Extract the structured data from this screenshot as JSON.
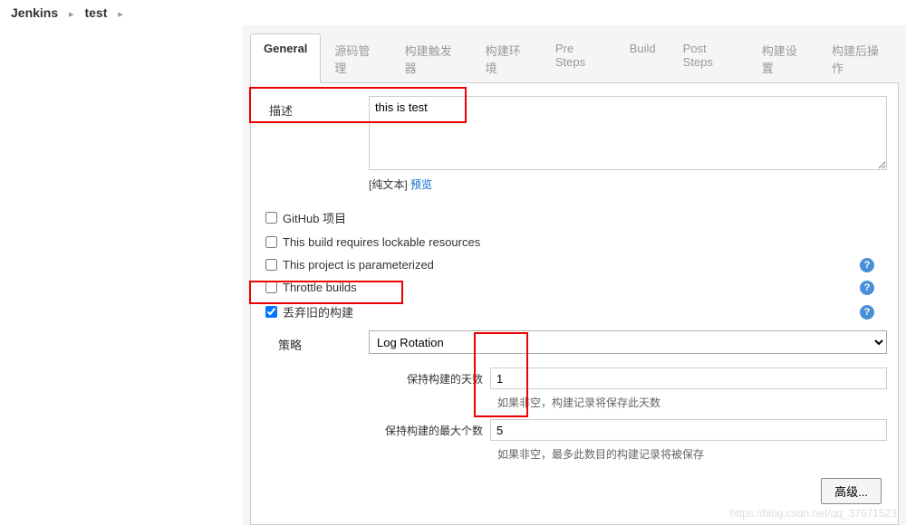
{
  "breadcrumb": {
    "root": "Jenkins",
    "item": "test"
  },
  "tabs": {
    "general": "General",
    "scm": "源码管理",
    "triggers": "构建触发器",
    "env": "构建环境",
    "pre": "Pre Steps",
    "build": "Build",
    "post": "Post Steps",
    "settings": "构建设置",
    "postactions": "构建后操作"
  },
  "form": {
    "desc_label": "描述",
    "desc_value": "this is test",
    "desc_hint_prefix": "[纯文本] ",
    "desc_hint_link": "预览",
    "chk_github": "GitHub 项目",
    "chk_lockable": "This build requires lockable resources",
    "chk_param": "This project is parameterized",
    "chk_throttle": "Throttle builds",
    "chk_discard": "丢弃旧的构建",
    "strategy_label": "策略",
    "strategy_value": "Log Rotation",
    "days_label": "保持构建的天数",
    "days_value": "1",
    "days_desc": "如果非空，构建记录将保存此天数",
    "max_label": "保持构建的最大个数",
    "max_value": "5",
    "max_desc": "如果非空，最多此数目的构建记录将被保存",
    "advanced_btn": "高级..."
  },
  "watermark": "https://blog.csdn.net/qq_37671523"
}
